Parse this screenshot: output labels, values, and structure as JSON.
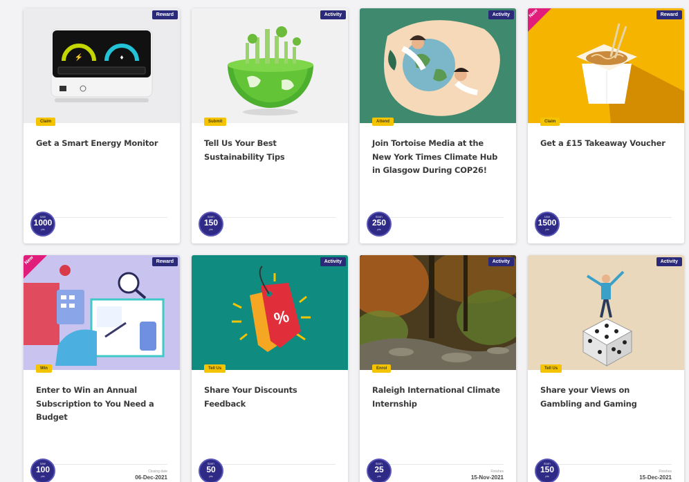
{
  "cards": [
    {
      "type": "Reward",
      "action": "Claim",
      "title": "Get a Smart Energy Monitor",
      "points_top": "Use",
      "points": "1000",
      "points_unit": "pts",
      "new": false,
      "closing_label": "",
      "closing_date": ""
    },
    {
      "type": "Activity",
      "action": "Submit",
      "title": "Tell Us Your Best Sustainability Tips",
      "points_top": "Earn",
      "points": "150",
      "points_unit": "pts",
      "new": false,
      "closing_label": "",
      "closing_date": ""
    },
    {
      "type": "Activity",
      "action": "Attend",
      "title": "Join Tortoise Media at the New York Times Climate Hub in Glasgow During COP26!",
      "points_top": "Earn",
      "points": "250",
      "points_unit": "pts",
      "new": false,
      "closing_label": "",
      "closing_date": ""
    },
    {
      "type": "Reward",
      "action": "Claim",
      "title": "Get a £15 Takeaway Voucher",
      "points_top": "Use",
      "points": "1500",
      "points_unit": "pts",
      "new": true,
      "new_label": "New",
      "closing_label": "",
      "closing_date": ""
    },
    {
      "type": "Reward",
      "action": "Win",
      "title": "Enter to Win an Annual Subscription to You Need a Budget",
      "points_top": "Use",
      "points": "100",
      "points_unit": "pts",
      "new": true,
      "new_label": "New",
      "closing_label": "Closing date",
      "closing_date": "06-Dec-2021"
    },
    {
      "type": "Activity",
      "action": "Tell Us",
      "title": "Share Your Discounts Feedback",
      "points_top": "Earn",
      "points": "50",
      "points_unit": "pts",
      "new": false,
      "closing_label": "",
      "closing_date": ""
    },
    {
      "type": "Activity",
      "action": "Enrol",
      "title": "Raleigh International Climate Internship",
      "points_top": "Earn",
      "points": "25",
      "points_unit": "pts",
      "new": false,
      "closing_label": "Finishes",
      "closing_date": "15-Nov-2021"
    },
    {
      "type": "Activity",
      "action": "Tell Us",
      "title": "Share your Views on Gambling and Gaming",
      "points_top": "Earn",
      "points": "150",
      "points_unit": "pts",
      "new": false,
      "closing_label": "Finishes",
      "closing_date": "15-Dec-2021"
    }
  ],
  "colors": {
    "badge": "#2e2a86",
    "tag": "#f5c400",
    "type_tag": "#2b2a7a",
    "new_ribbon": "#e01d7a"
  }
}
